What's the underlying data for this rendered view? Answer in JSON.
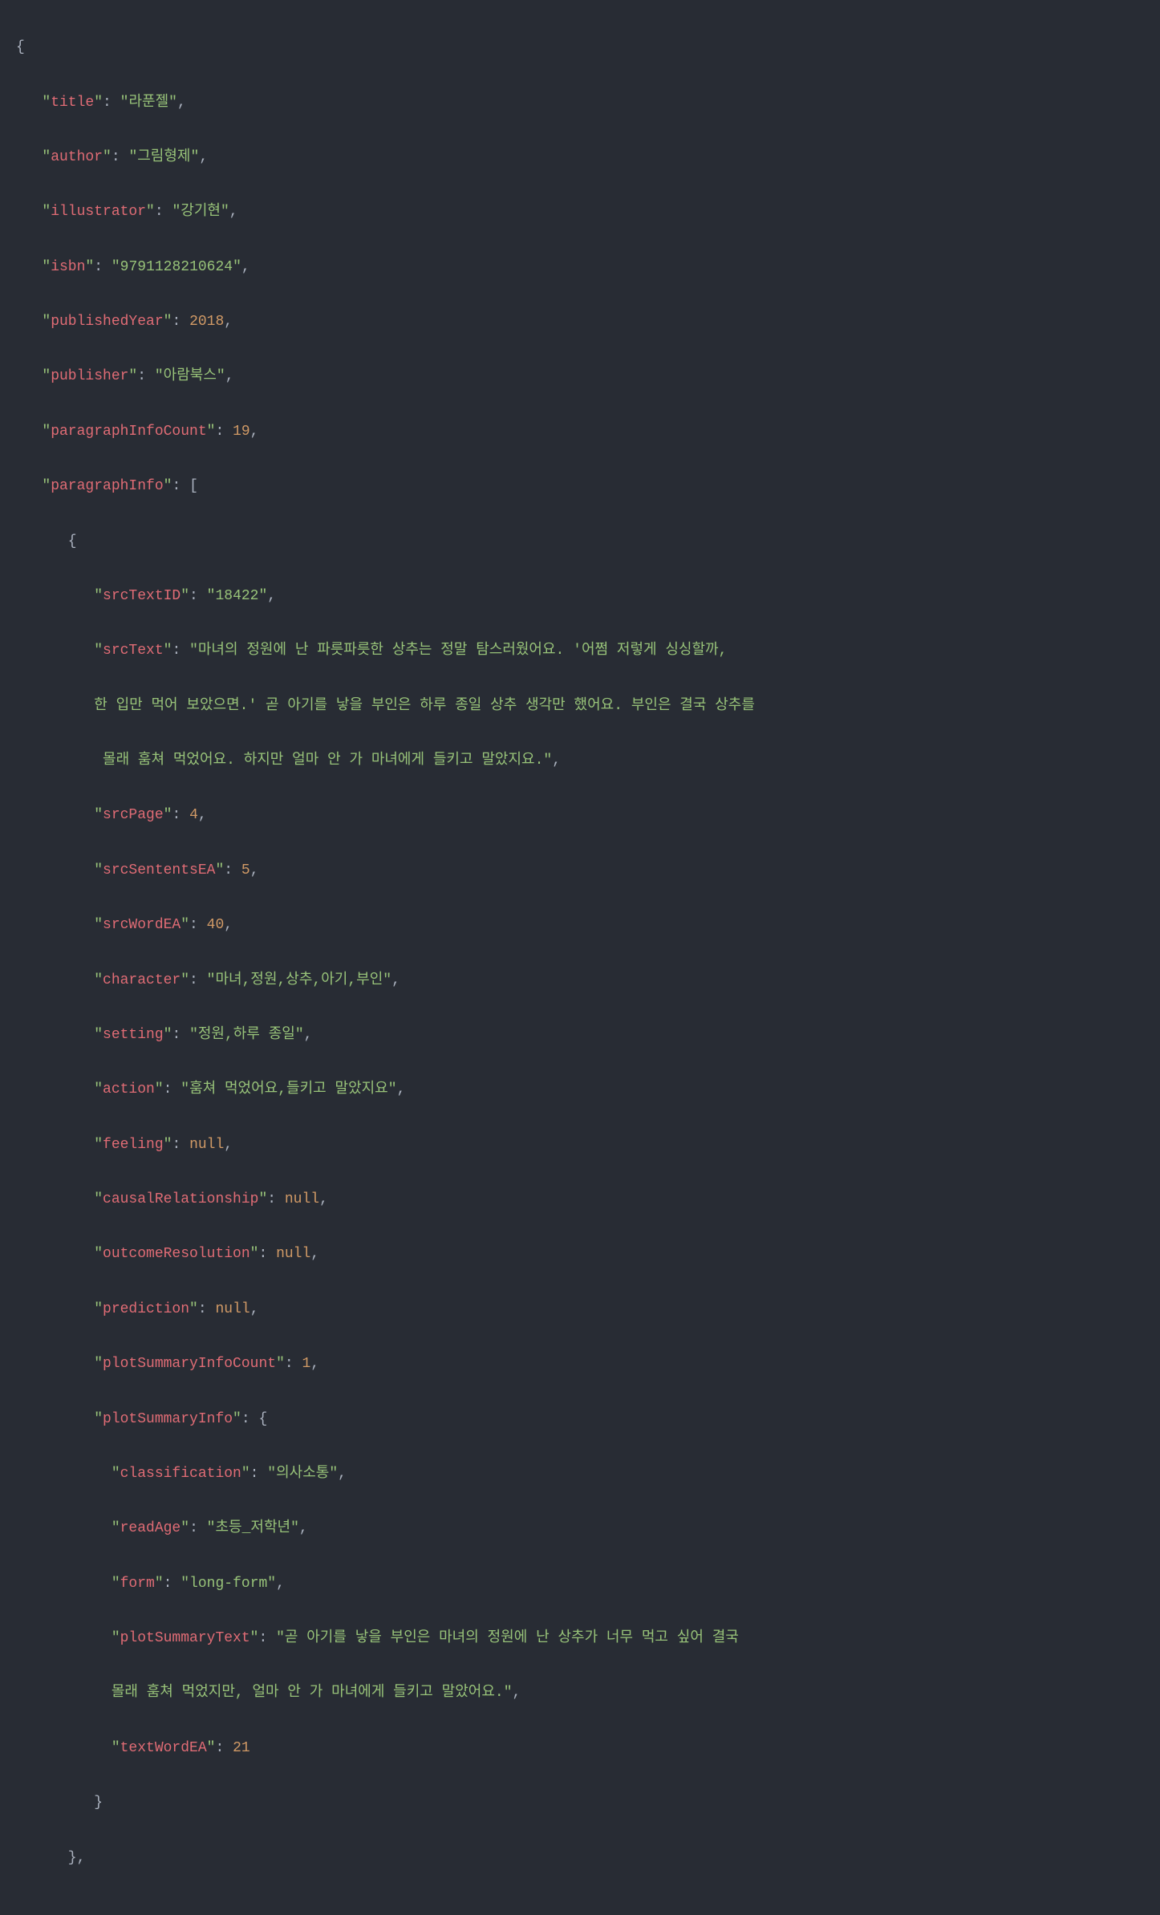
{
  "json": {
    "title": {
      "key": "title",
      "value": "라푼젤"
    },
    "author": {
      "key": "author",
      "value": "그림형제"
    },
    "illustrator": {
      "key": "illustrator",
      "value": "강기현"
    },
    "isbn": {
      "key": "isbn",
      "value": "9791128210624"
    },
    "publishedYear": {
      "key": "publishedYear",
      "value": "2018"
    },
    "publisher": {
      "key": "publisher",
      "value": "아람북스"
    },
    "paragraphInfoCount": {
      "key": "paragraphInfoCount",
      "value": "19"
    },
    "paragraphInfo": {
      "key": "paragraphInfo"
    },
    "srcTextID": {
      "key": "srcTextID",
      "value": "18422"
    },
    "srcText": {
      "key": "srcText",
      "line1": "\"마녀의 정원에 난 파릇파릇한 상추는 정말 탐스러웠어요. '어쩜 저렇게 싱싱할까,",
      "line2": "한 입만 먹어 보았으면.' 곧 아기를 낳을 부인은 하루 종일 상추 생각만 했어요. 부인은 결국 상추를",
      "line3": " 몰래 훔쳐 먹었어요. 하지만 얼마 안 가 마녀에게 들키고 말았지요.\""
    },
    "srcPage": {
      "key": "srcPage",
      "value": "4"
    },
    "srcSententsEA": {
      "key": "srcSententsEA",
      "value": "5"
    },
    "srcWordEA": {
      "key": "srcWordEA",
      "value": "40"
    },
    "character": {
      "key": "character",
      "value": "마녀,정원,상추,아기,부인"
    },
    "setting": {
      "key": "setting",
      "value": "정원,하루 종일"
    },
    "action": {
      "key": "action",
      "value": "훔쳐 먹었어요,들키고 말았지요"
    },
    "feeling": {
      "key": "feeling",
      "value": "null"
    },
    "causalRelationship": {
      "key": "causalRelationship",
      "value": "null"
    },
    "outcomeResolution": {
      "key": "outcomeResolution",
      "value": "null"
    },
    "prediction": {
      "key": "prediction",
      "value": "null"
    },
    "plotSummaryInfoCount": {
      "key": "plotSummaryInfoCount",
      "value": "1"
    },
    "plotSummaryInfo": {
      "key": "plotSummaryInfo"
    },
    "classification": {
      "key": "classification",
      "value": "의사소통"
    },
    "readAge": {
      "key": "readAge",
      "value": "초등_저학년"
    },
    "form": {
      "key": "form",
      "value": "long-form"
    },
    "plotSummaryText": {
      "key": "plotSummaryText",
      "line1": "\"곧 아기를 낳을 부인은 마녀의 정원에 난 상추가 너무 먹고 싶어 결국 ",
      "line2": "몰래 훔쳐 먹었지만, 얼마 안 가 마녀에게 들키고 말았어요.\""
    },
    "textWordEA": {
      "key": "textWordEA",
      "value": "21"
    }
  }
}
